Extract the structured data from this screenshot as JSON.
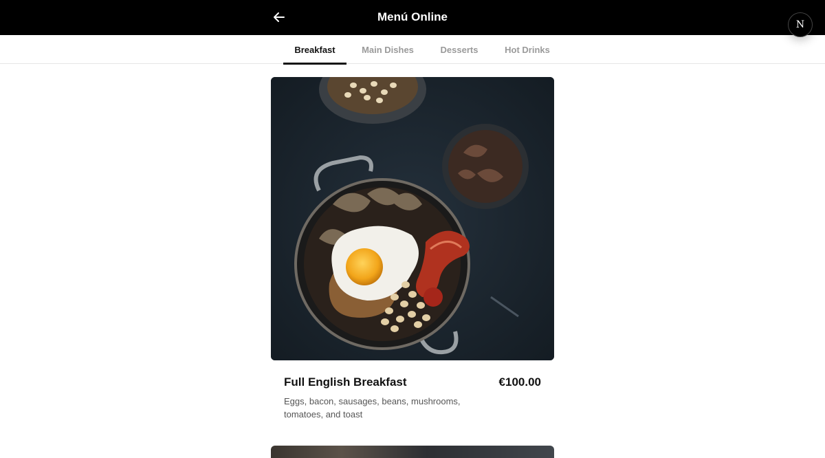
{
  "header": {
    "title": "Menú Online",
    "back_icon": "arrow-left-icon",
    "badge_letter": "N"
  },
  "tabs": [
    {
      "label": "Breakfast",
      "active": true
    },
    {
      "label": "Main Dishes",
      "active": false
    },
    {
      "label": "Desserts",
      "active": false
    },
    {
      "label": "Hot Drinks",
      "active": false
    }
  ],
  "items": [
    {
      "name": "Full English Breakfast",
      "price": "€100.00",
      "description": "Eggs, bacon, sausages, beans, mushrooms, tomatoes, and toast"
    }
  ],
  "colors": {
    "header_bg": "#000000",
    "active_tab": "#111111",
    "inactive_tab": "#9a9a9a"
  }
}
